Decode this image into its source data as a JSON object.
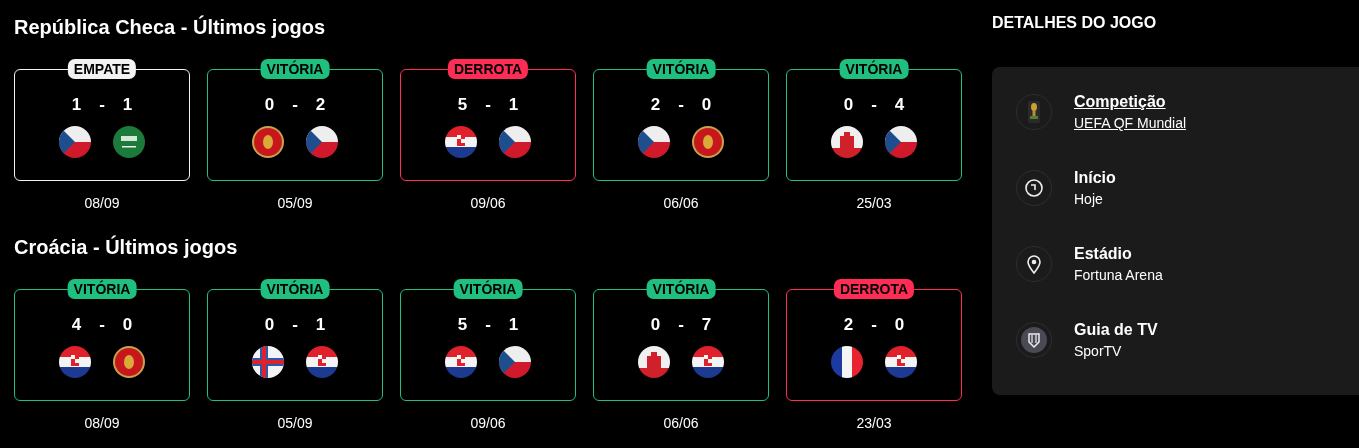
{
  "sections": [
    {
      "title": "República Checa - Últimos jogos",
      "games": [
        {
          "result": {
            "kind": "draw",
            "label": "EMPATE"
          },
          "home": {
            "score": "1",
            "kind": "cz"
          },
          "separator": "-",
          "away": {
            "score": "1",
            "kind": "sa"
          },
          "date": "08/09"
        },
        {
          "result": {
            "kind": "win",
            "label": "VITÓRIA"
          },
          "home": {
            "score": "0",
            "kind": "me"
          },
          "separator": "-",
          "away": {
            "score": "2",
            "kind": "cz"
          },
          "date": "05/09"
        },
        {
          "result": {
            "kind": "loss",
            "label": "DERROTA"
          },
          "home": {
            "score": "5",
            "kind": "hr"
          },
          "separator": "-",
          "away": {
            "score": "1",
            "kind": "cz"
          },
          "date": "09/06"
        },
        {
          "result": {
            "kind": "win",
            "label": "VITÓRIA"
          },
          "home": {
            "score": "2",
            "kind": "cz"
          },
          "separator": "-",
          "away": {
            "score": "0",
            "kind": "me"
          },
          "date": "06/06"
        },
        {
          "result": {
            "kind": "win",
            "label": "VITÓRIA"
          },
          "home": {
            "score": "0",
            "kind": "gi"
          },
          "separator": "-",
          "away": {
            "score": "4",
            "kind": "cz"
          },
          "date": "25/03"
        }
      ]
    },
    {
      "title": "Croácia - Últimos jogos",
      "games": [
        {
          "result": {
            "kind": "win",
            "label": "VITÓRIA"
          },
          "home": {
            "score": "4",
            "kind": "hr"
          },
          "separator": "-",
          "away": {
            "score": "0",
            "kind": "me"
          },
          "date": "08/09"
        },
        {
          "result": {
            "kind": "win",
            "label": "VITÓRIA"
          },
          "home": {
            "score": "0",
            "kind": "fo"
          },
          "separator": "-",
          "away": {
            "score": "1",
            "kind": "hr"
          },
          "date": "05/09"
        },
        {
          "result": {
            "kind": "win",
            "label": "VITÓRIA"
          },
          "home": {
            "score": "5",
            "kind": "hr"
          },
          "separator": "-",
          "away": {
            "score": "1",
            "kind": "cz"
          },
          "date": "09/06"
        },
        {
          "result": {
            "kind": "win",
            "label": "VITÓRIA"
          },
          "home": {
            "score": "0",
            "kind": "gi"
          },
          "separator": "-",
          "away": {
            "score": "7",
            "kind": "hr"
          },
          "date": "06/06"
        },
        {
          "result": {
            "kind": "loss",
            "label": "DERROTA"
          },
          "home": {
            "score": "2",
            "kind": "fr"
          },
          "separator": "-",
          "away": {
            "score": "0",
            "kind": "hr"
          },
          "date": "23/03"
        }
      ]
    }
  ],
  "details": {
    "title": "DETALHES DO JOGO",
    "items": [
      {
        "kind": "trophy",
        "label": "Competição",
        "value": "UEFA QF Mundial",
        "link": true
      },
      {
        "kind": "clock",
        "label": "Início",
        "value": "Hoje",
        "link": false
      },
      {
        "kind": "pin",
        "label": "Estádio",
        "value": "Fortuna Arena",
        "link": false
      },
      {
        "kind": "tv",
        "label": "Guia de TV",
        "value": "SporTV",
        "link": false
      }
    ]
  }
}
